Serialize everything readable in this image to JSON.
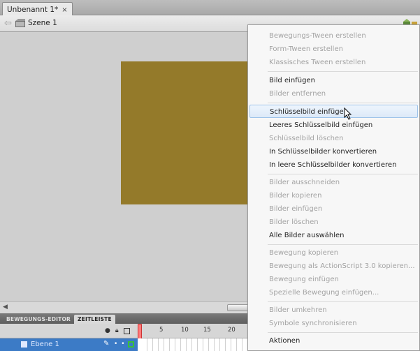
{
  "document": {
    "tab_title": "Unbenannt 1*",
    "close_glyph": "×"
  },
  "edit_bar": {
    "scene_label": "Szene 1",
    "back_icon": "back-arrow-icon"
  },
  "timeline": {
    "tabs": [
      "BEWEGUNGS-EDITOR",
      "ZEITLEISTE"
    ],
    "frame_numbers": [
      "5",
      "10",
      "15",
      "20"
    ],
    "layer": {
      "name": "Ebene 1"
    }
  },
  "context_menu": {
    "items": [
      {
        "label": "Bewegungs-Tween erstellen",
        "enabled": false
      },
      {
        "label": "Form-Tween erstellen",
        "enabled": false
      },
      {
        "label": "Klassisches Tween erstellen",
        "enabled": false
      },
      {
        "label": "Bild einfügen",
        "enabled": true
      },
      {
        "label": "Bilder entfernen",
        "enabled": false
      },
      {
        "label": "Schlüsselbild einfügen",
        "enabled": true,
        "highlighted": true
      },
      {
        "label": "Leeres Schlüsselbild einfügen",
        "enabled": true
      },
      {
        "label": "Schlüsselbild löschen",
        "enabled": false
      },
      {
        "label": "In Schlüsselbilder konvertieren",
        "enabled": true
      },
      {
        "label": "In leere Schlüsselbilder konvertieren",
        "enabled": true
      },
      {
        "label": "Bilder ausschneiden",
        "enabled": false
      },
      {
        "label": "Bilder kopieren",
        "enabled": false
      },
      {
        "label": "Bilder einfügen",
        "enabled": false
      },
      {
        "label": "Bilder löschen",
        "enabled": false
      },
      {
        "label": "Alle Bilder auswählen",
        "enabled": true
      },
      {
        "label": "Bewegung kopieren",
        "enabled": false
      },
      {
        "label": "Bewegung als ActionScript 3.0 kopieren...",
        "enabled": false
      },
      {
        "label": "Bewegung einfügen",
        "enabled": false
      },
      {
        "label": "Spezielle Bewegung einfügen...",
        "enabled": false
      },
      {
        "label": "Bilder umkehren",
        "enabled": false
      },
      {
        "label": "Symbole synchronisieren",
        "enabled": false
      },
      {
        "label": "Aktionen",
        "enabled": true
      }
    ]
  },
  "colors": {
    "stage_object": "#947a2a",
    "layer_highlight": "#3c7bc6",
    "playhead": "#ff7a7a",
    "menu_hover": "#dce9f8"
  }
}
